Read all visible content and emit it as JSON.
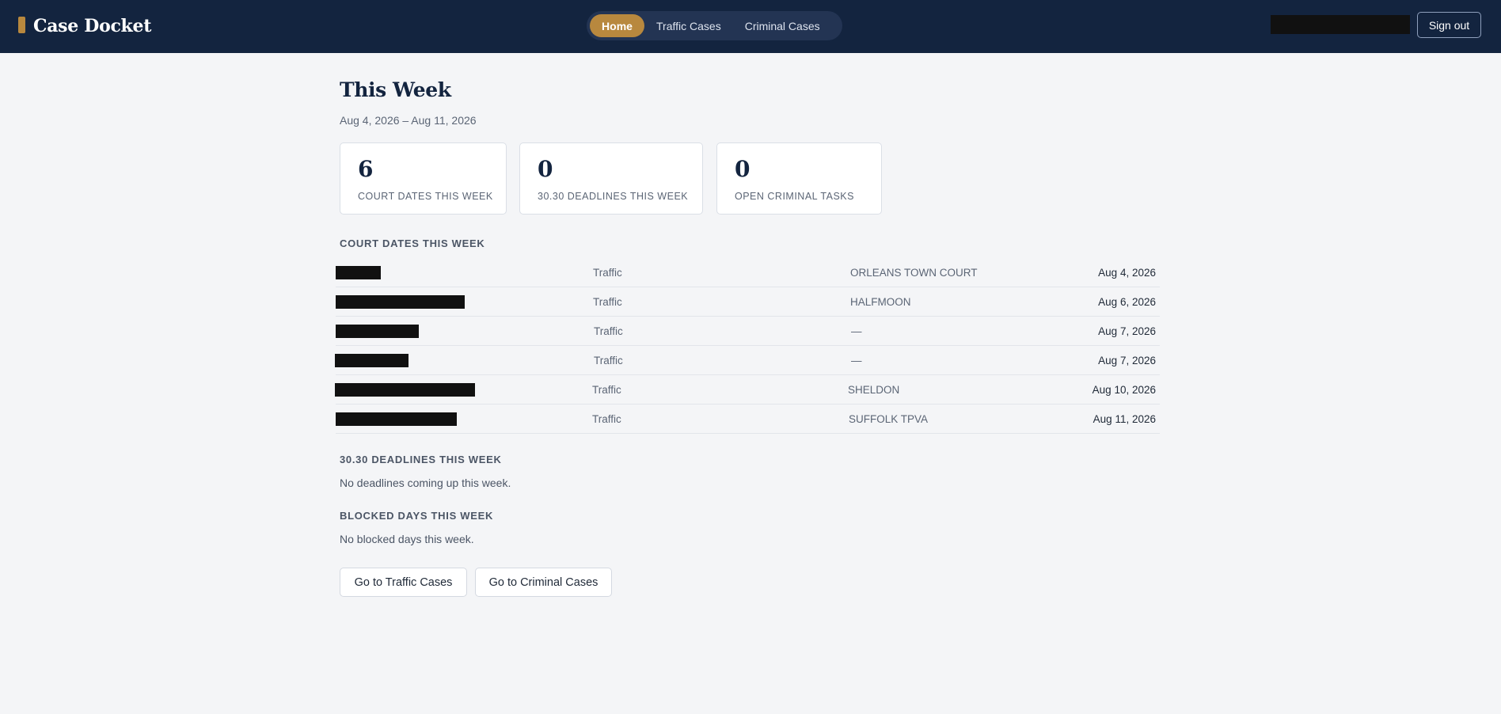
{
  "app": {
    "title": "Case Docket"
  },
  "nav": {
    "tabs": [
      {
        "label": "Home",
        "active": true
      },
      {
        "label": "Traffic Cases",
        "active": false
      },
      {
        "label": "Criminal Cases",
        "active": false
      }
    ]
  },
  "header": {
    "sign_out_label": "Sign out"
  },
  "colors": {
    "topbar": "#13243f",
    "accent": "#b8883e",
    "background": "#f4f5f7"
  },
  "page": {
    "title": "This Week",
    "date_range": "Aug 4, 2026 – Aug 11, 2026"
  },
  "stats": [
    {
      "value": "6",
      "label": "COURT DATES THIS WEEK"
    },
    {
      "value": "0",
      "label": "30.30 DEADLINES THIS WEEK"
    },
    {
      "value": "0",
      "label": "OPEN CRIMINAL TASKS"
    }
  ],
  "court_dates": {
    "heading": "COURT DATES THIS WEEK",
    "rows": [
      {
        "type": "Traffic",
        "court": "ORLEANS TOWN COURT",
        "date": "Aug 4, 2026"
      },
      {
        "type": "Traffic",
        "court": "HALFMOON",
        "date": "Aug 6, 2026"
      },
      {
        "type": "Traffic",
        "court": "—",
        "date": "Aug 7, 2026"
      },
      {
        "type": "Traffic",
        "court": "—",
        "date": "Aug 7, 2026"
      },
      {
        "type": "Traffic",
        "court": "SHELDON",
        "date": "Aug 10, 2026"
      },
      {
        "type": "Traffic",
        "court": "SUFFOLK TPVA",
        "date": "Aug 11, 2026"
      }
    ]
  },
  "deadlines": {
    "heading": "30.30 DEADLINES THIS WEEK",
    "empty": "No deadlines coming up this week."
  },
  "blocked": {
    "heading": "BLOCKED DAYS THIS WEEK",
    "empty": "No blocked days this week."
  },
  "actions": {
    "traffic_label": "Go to Traffic Cases",
    "criminal_label": "Go to Criminal Cases"
  }
}
